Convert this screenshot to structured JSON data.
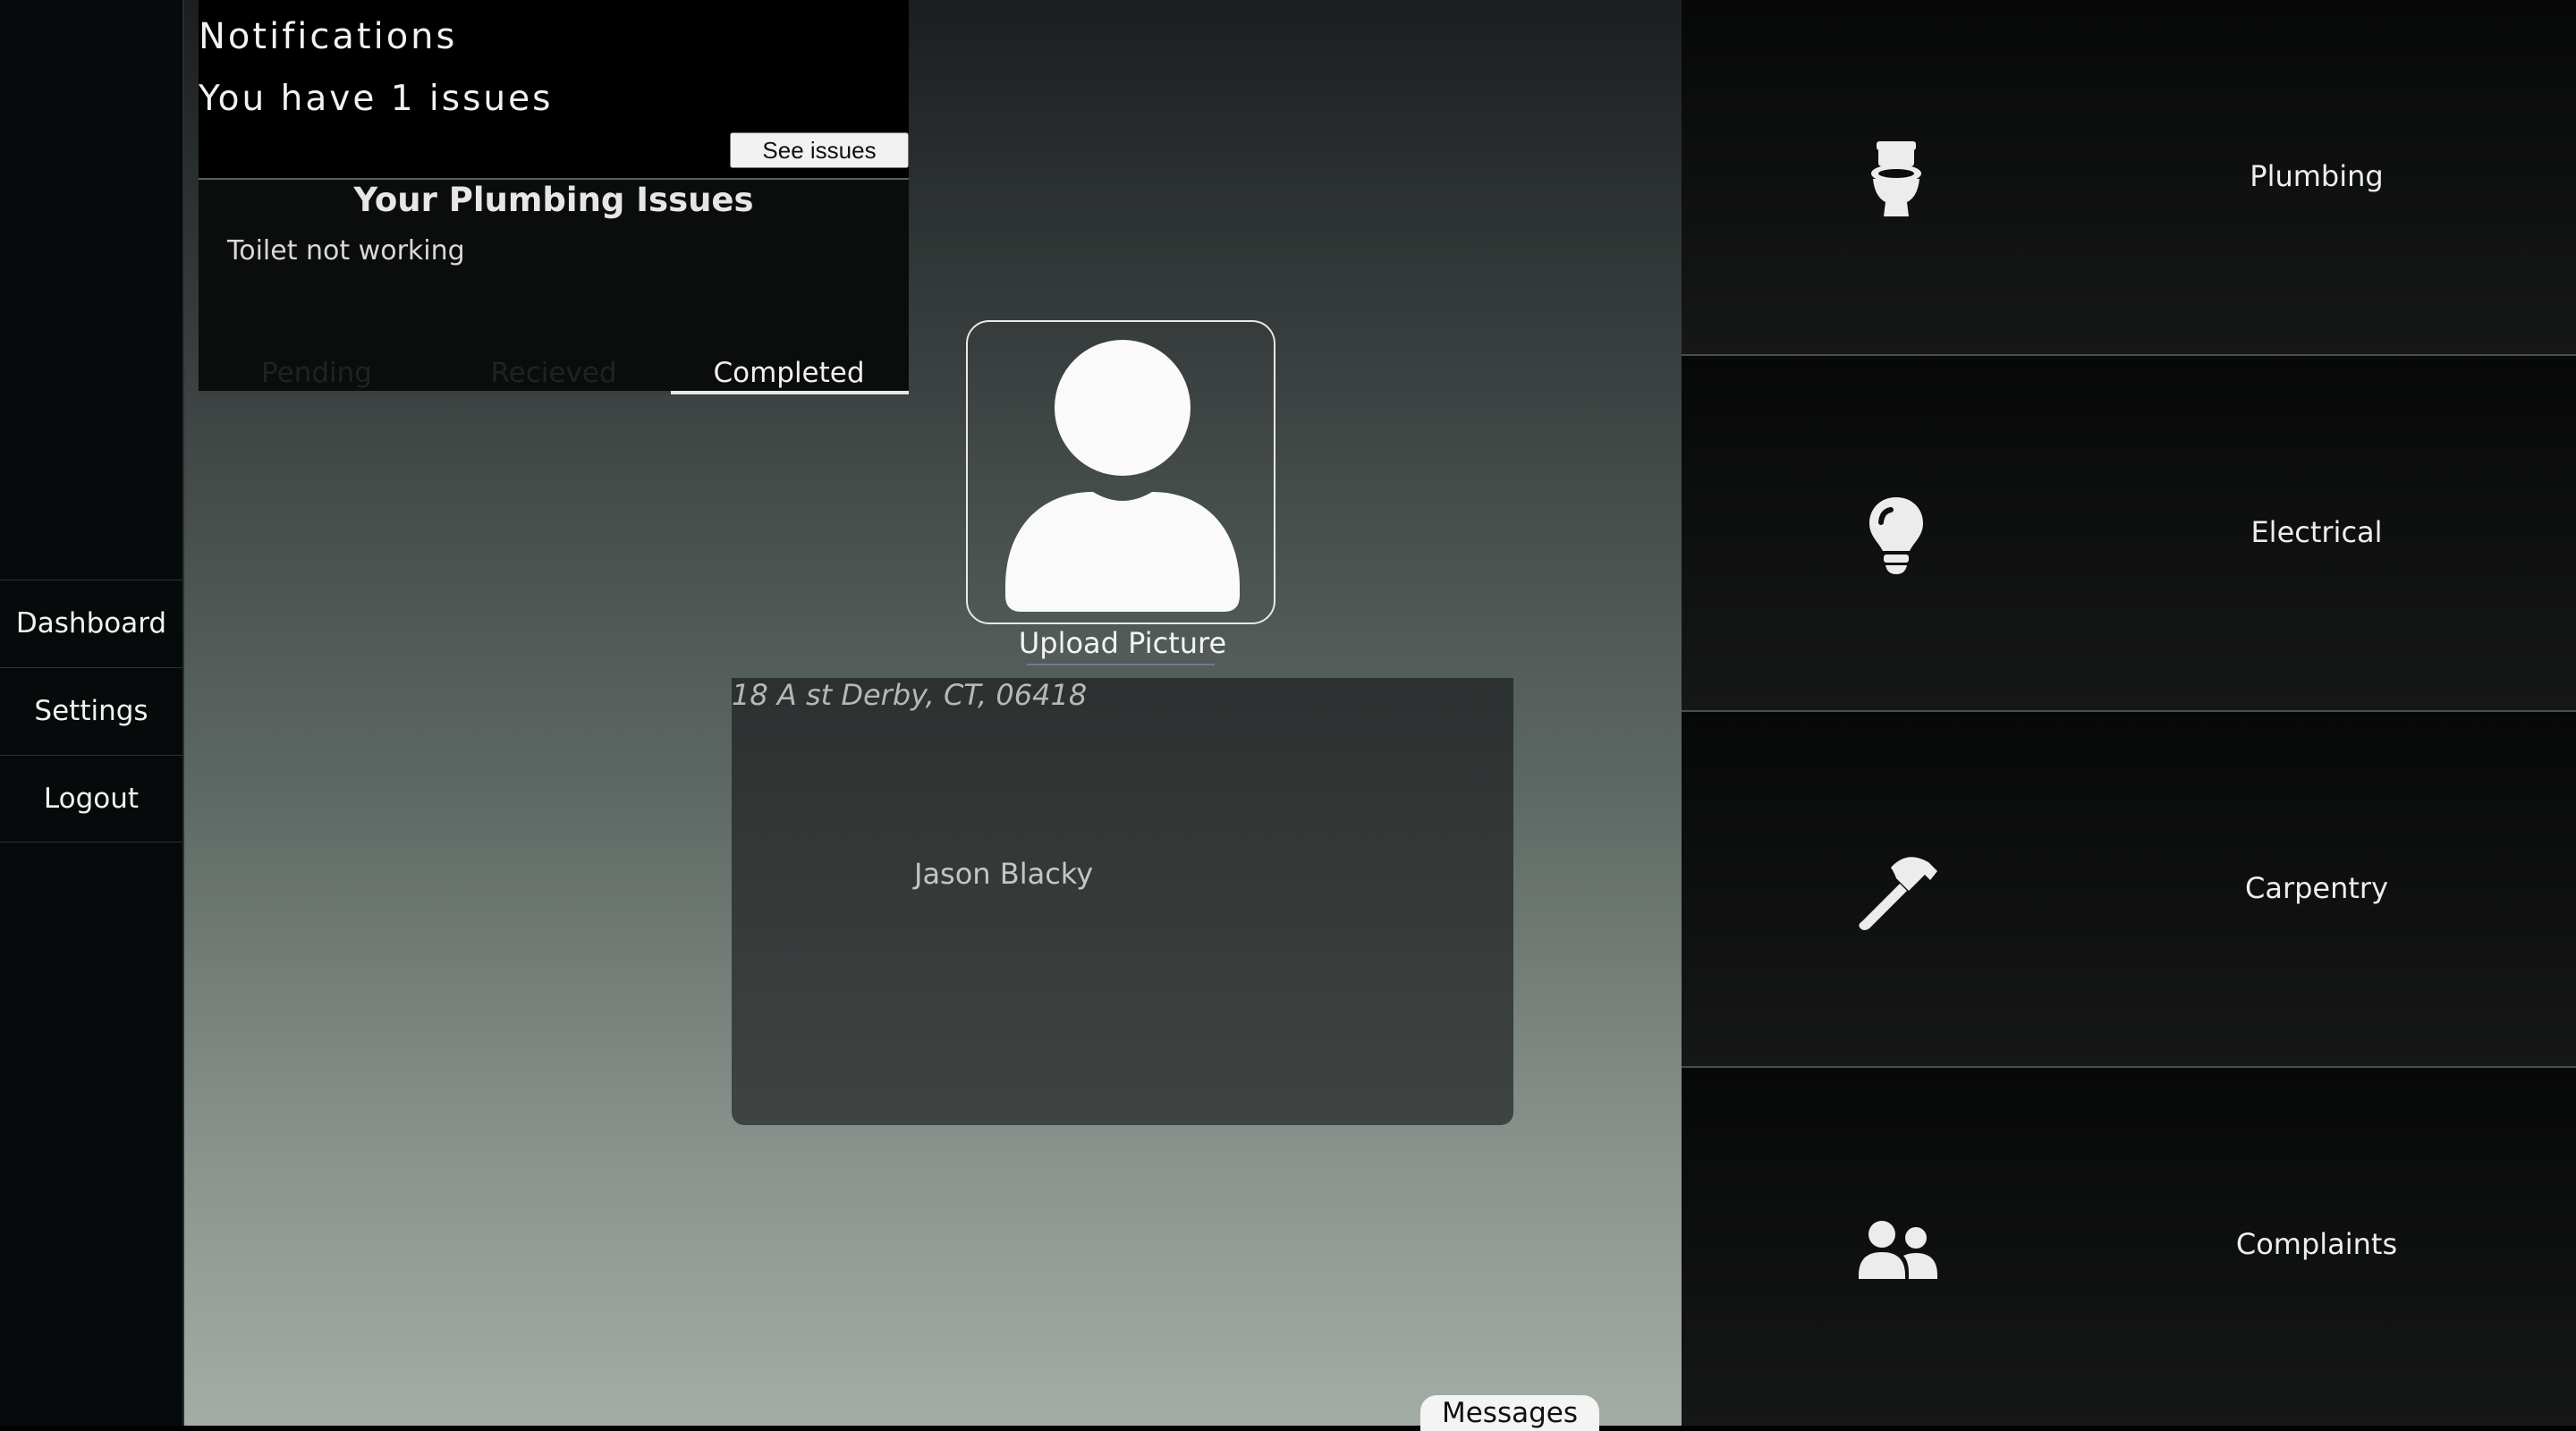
{
  "sidebar": {
    "items": [
      {
        "label": "Dashboard"
      },
      {
        "label": "Settings"
      },
      {
        "label": "Logout"
      }
    ]
  },
  "notifications": {
    "title": "Notifications",
    "count_text": "You have 1 issues",
    "see_issues_label": "See issues"
  },
  "issues": {
    "title": "Your Plumbing Issues",
    "items": [
      "Toilet not working"
    ],
    "tabs": [
      {
        "label": "Pending",
        "active": false
      },
      {
        "label": "Recieved",
        "active": false
      },
      {
        "label": "Completed",
        "active": true
      }
    ]
  },
  "profile": {
    "avatar_icon": "user-icon",
    "upload_label": "Upload Picture",
    "address": "18 A st Derby, CT, 06418",
    "name": "Jason Blacky"
  },
  "messages_label": "Messages",
  "categories": [
    {
      "label": "Plumbing",
      "icon": "toilet-icon"
    },
    {
      "label": "Electrical",
      "icon": "lightbulb-icon"
    },
    {
      "label": "Carpentry",
      "icon": "hammer-icon"
    },
    {
      "label": "Complaints",
      "icon": "users-icon"
    }
  ]
}
